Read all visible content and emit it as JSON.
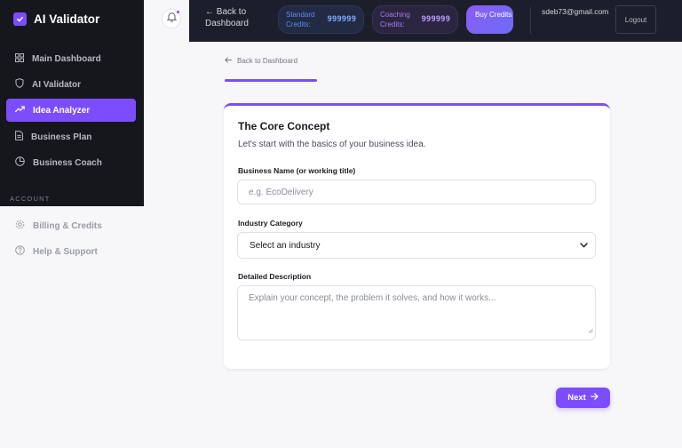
{
  "app": {
    "name": "AI Validator"
  },
  "sidebar": {
    "items": [
      {
        "label": "Main Dashboard",
        "icon": "grid-icon"
      },
      {
        "label": "AI Validator",
        "icon": "shield-icon"
      },
      {
        "label": "Idea Analyzer",
        "icon": "trending-up-icon",
        "active": true
      },
      {
        "label": "Business Plan",
        "icon": "document-icon"
      },
      {
        "label": "Business Coach",
        "icon": "pie-chart-icon"
      }
    ],
    "section_label": "ACCOUNT",
    "account_items": [
      {
        "label": "Billing & Credits",
        "icon": "gear-icon"
      },
      {
        "label": "Help & Support",
        "icon": "help-circle-icon"
      }
    ]
  },
  "topbar": {
    "back_label": "← Back to Dashboard",
    "standard_credits": {
      "label": "Standard Credits:",
      "value": "999999"
    },
    "coaching_credits": {
      "label": "Coaching Credits:",
      "value": "999999"
    },
    "buy_label": "Buy Credits",
    "email": "sdeb73@gmail.com",
    "logout_label": "Logout"
  },
  "main": {
    "back_link": "Back to Dashboard",
    "progress_fraction": 0.24,
    "card": {
      "title": "The Core Concept",
      "subtitle": "Let's start with the basics of your business idea.",
      "business_name_label": "Business Name (or working title)",
      "business_name_placeholder": "e.g. EcoDelivery",
      "industry_label": "Industry Category",
      "industry_selected": "Select an industry",
      "description_label": "Detailed Description",
      "description_placeholder": "Explain your concept, the problem it solves, and how it works..."
    },
    "next_label": "Next"
  },
  "colors": {
    "accent": "#7c4dff",
    "sidebar_bg": "#16171d",
    "topbar_bg": "#1c1f2b",
    "page_bg": "#f7f7f9"
  }
}
